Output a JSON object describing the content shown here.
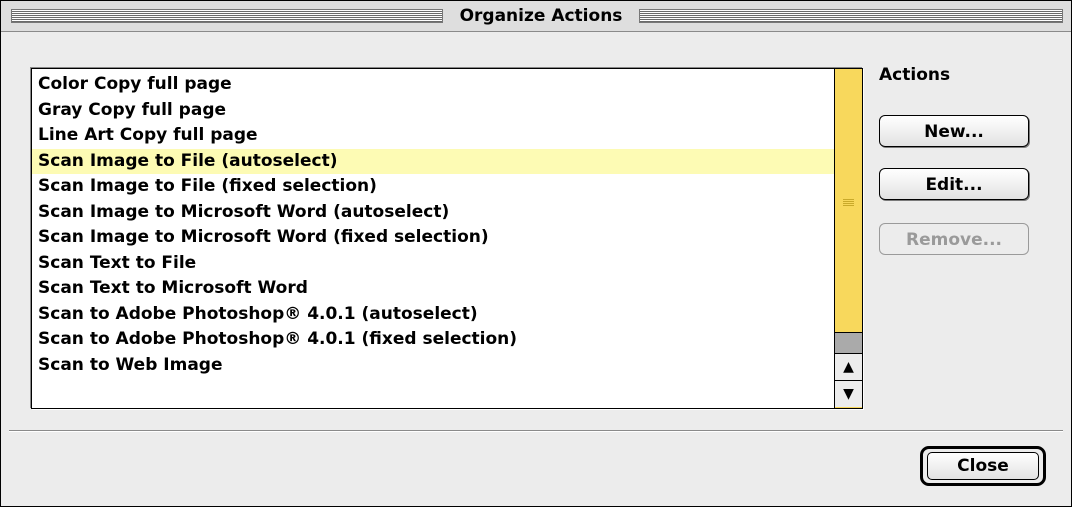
{
  "window": {
    "title": "Organize Actions"
  },
  "actions_list": {
    "items": [
      "Color Copy full page",
      "Gray Copy full page",
      "Line Art Copy full page",
      "Scan Image to File (autoselect)",
      "Scan Image to File (fixed selection)",
      "Scan Image to Microsoft Word (autoselect)",
      "Scan Image to Microsoft Word (fixed selection)",
      "Scan Text to File",
      "Scan Text to Microsoft Word",
      "Scan to Adobe Photoshop® 4.0.1 (autoselect)",
      "Scan to Adobe Photoshop® 4.0.1 (fixed selection)",
      "Scan to Web Image"
    ],
    "selected_item": "Scan Image to File (autoselect)"
  },
  "actions_panel": {
    "label": "Actions",
    "new_label": "New...",
    "edit_label": "Edit...",
    "remove_label": "Remove..."
  },
  "footer": {
    "close_label": "Close"
  },
  "colors": {
    "selection_highlight": "#fdfbb4",
    "scrollbar": "#f8d85c",
    "window_bg": "#ececec"
  }
}
